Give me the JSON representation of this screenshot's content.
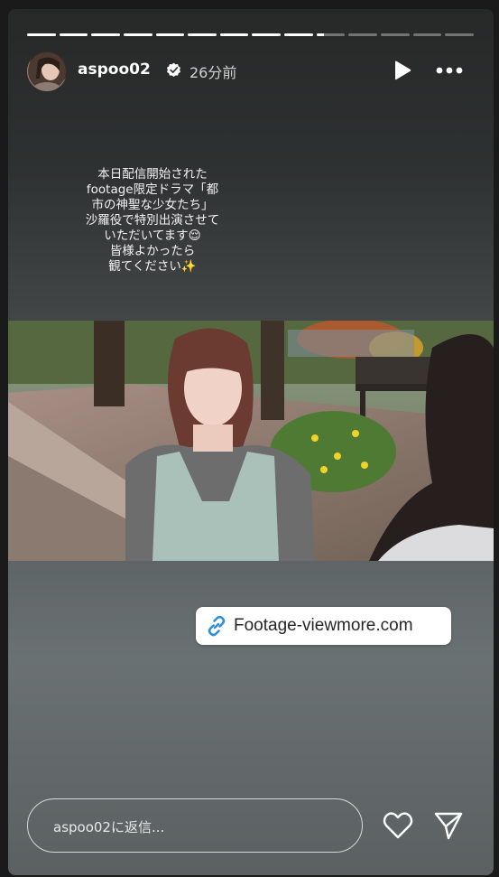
{
  "story": {
    "progress": {
      "total_segments": 14,
      "completed_segments": 9,
      "current_fraction": 0.25
    },
    "user": {
      "username": "aspoo02",
      "verified": true,
      "time_ago": "26分前"
    },
    "icons": {
      "avatar": "profile-avatar",
      "verified": "verified-badge-icon",
      "play": "play-icon",
      "more": "more-options-icon",
      "link": "link-icon",
      "heart": "heart-icon",
      "send": "send-icon"
    },
    "caption": "本日配信開始された\nfootage限定ドラマ「都\n市の神聖な少女たち」\n沙羅役で特別出演させて\nいただいてます😌\n皆様よかったら\n観てください✨",
    "photo": {
      "description_name": "drama-still-photo"
    },
    "link_sticker": {
      "label": "Footage-viewmore.com"
    },
    "reply": {
      "placeholder": "aspoo02に返信..."
    }
  },
  "colors": {
    "background": "#1a1a1a",
    "story_gradient_top": "#262928",
    "story_gradient_bottom": "#6a7172",
    "link_blue": "#2f8fd6"
  }
}
